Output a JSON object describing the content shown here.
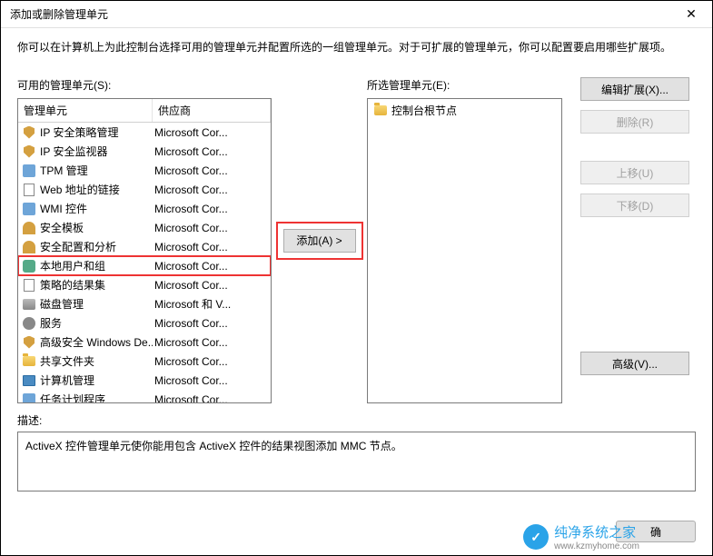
{
  "window": {
    "title": "添加或删除管理单元",
    "close": "✕"
  },
  "intro": "你可以在计算机上为此控制台选择可用的管理单元并配置所选的一组管理单元。对于可扩展的管理单元，你可以配置要启用哪些扩展项。",
  "available": {
    "label": "可用的管理单元(S):",
    "columns": {
      "name": "管理单元",
      "vendor": "供应商"
    },
    "items": [
      {
        "name": "IP 安全策略管理",
        "vendor": "Microsoft Cor...",
        "icon": "shield",
        "highlight": false
      },
      {
        "name": "IP 安全监视器",
        "vendor": "Microsoft Cor...",
        "icon": "shield",
        "highlight": false
      },
      {
        "name": "TPM 管理",
        "vendor": "Microsoft Cor...",
        "icon": "generic",
        "highlight": false
      },
      {
        "name": "Web 地址的链接",
        "vendor": "Microsoft Cor...",
        "icon": "doc",
        "highlight": false
      },
      {
        "name": "WMI 控件",
        "vendor": "Microsoft Cor...",
        "icon": "generic",
        "highlight": false
      },
      {
        "name": "安全模板",
        "vendor": "Microsoft Cor...",
        "icon": "key",
        "highlight": false
      },
      {
        "name": "安全配置和分析",
        "vendor": "Microsoft Cor...",
        "icon": "key",
        "highlight": false
      },
      {
        "name": "本地用户和组",
        "vendor": "Microsoft Cor...",
        "icon": "people",
        "highlight": true
      },
      {
        "name": "策略的结果集",
        "vendor": "Microsoft Cor...",
        "icon": "doc",
        "highlight": false
      },
      {
        "name": "磁盘管理",
        "vendor": "Microsoft 和 V...",
        "icon": "disk",
        "highlight": false
      },
      {
        "name": "服务",
        "vendor": "Microsoft Cor...",
        "icon": "gear",
        "highlight": false
      },
      {
        "name": "高级安全 Windows De...",
        "vendor": "Microsoft Cor...",
        "icon": "shield",
        "highlight": false
      },
      {
        "name": "共享文件夹",
        "vendor": "Microsoft Cor...",
        "icon": "folder",
        "highlight": false
      },
      {
        "name": "计算机管理",
        "vendor": "Microsoft Cor...",
        "icon": "computer",
        "highlight": false
      },
      {
        "name": "任务计划程序",
        "vendor": "Microsoft Cor...",
        "icon": "generic",
        "highlight": false
      }
    ]
  },
  "addButton": "添加(A) >",
  "selected": {
    "label": "所选管理单元(E):",
    "root": "控制台根节点"
  },
  "sideButtons": {
    "editExt": "编辑扩展(X)...",
    "remove": "删除(R)",
    "moveUp": "上移(U)",
    "moveDown": "下移(D)",
    "advanced": "高级(V)..."
  },
  "description": {
    "label": "描述:",
    "text": "ActiveX 控件管理单元使你能用包含 ActiveX 控件的结果视图添加 MMC 节点。"
  },
  "footer": {
    "ok": "确"
  },
  "watermark": {
    "name": "纯净系统之家",
    "url": "www.kzmyhome.com"
  }
}
